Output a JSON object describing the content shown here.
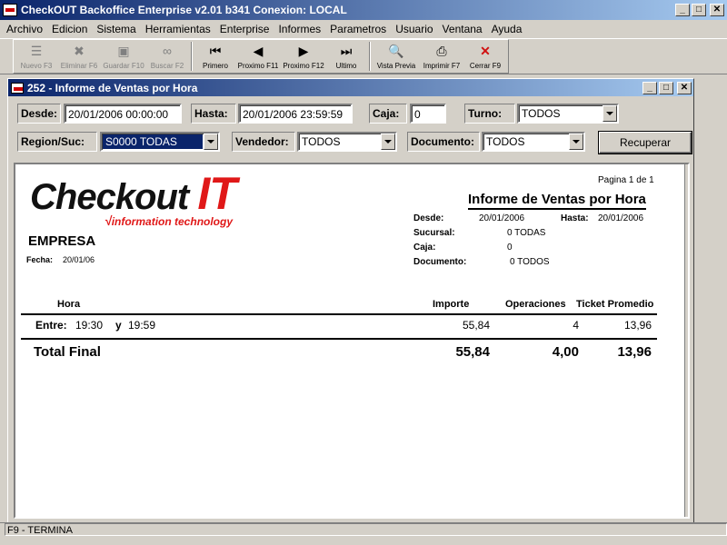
{
  "app": {
    "title": "CheckOUT Backoffice Enterprise v2.01 b341 Conexion: LOCAL"
  },
  "window_buttons": {
    "minimize": "_",
    "maximize": "□",
    "close": "✕"
  },
  "menu": [
    "Archivo",
    "Edicion",
    "Sistema",
    "Herramientas",
    "Enterprise",
    "Informes",
    "Parametros",
    "Usuario",
    "Ventana",
    "Ayuda"
  ],
  "toolbar": {
    "buttons": [
      {
        "label": "Nuevo F3",
        "icon": "new-icon",
        "glyph": "☰",
        "enabled": false
      },
      {
        "label": "Eliminar F6",
        "icon": "delete-icon",
        "glyph": "✖",
        "enabled": false
      },
      {
        "label": "Guardar F10",
        "icon": "save-icon",
        "glyph": "▣",
        "enabled": false
      },
      {
        "label": "Buscar F2",
        "icon": "binoculars-icon",
        "glyph": "∞",
        "enabled": false
      },
      {
        "label": "Primero",
        "icon": "first-icon",
        "glyph": "⏮",
        "enabled": true
      },
      {
        "label": "Proximo F11",
        "icon": "previous-icon",
        "glyph": "◀",
        "enabled": true
      },
      {
        "label": "Proximo F12",
        "icon": "next-icon",
        "glyph": "▶",
        "enabled": true
      },
      {
        "label": "Ultimo",
        "icon": "last-icon",
        "glyph": "⏭",
        "enabled": true
      },
      {
        "label": "Vista Previa",
        "icon": "preview-icon",
        "glyph": "🔍",
        "enabled": true
      },
      {
        "label": "Imprimir F7",
        "icon": "printer-icon",
        "glyph": "⎙",
        "enabled": true
      },
      {
        "label": "Cerrar F9",
        "icon": "close-x-icon",
        "glyph": "✕",
        "enabled": true
      }
    ]
  },
  "child_window": {
    "title": "252 - Informe de Ventas por Hora"
  },
  "filters": {
    "desde_label": "Desde:",
    "desde_value": "20/01/2006 00:00:00",
    "hasta_label": "Hasta:",
    "hasta_value": "20/01/2006 23:59:59",
    "caja_label": "Caja:",
    "caja_value": "0",
    "turno_label": "Turno:",
    "turno_value": "TODOS",
    "region_label": "Region/Suc:",
    "region_value": "S0000 TODAS",
    "vendedor_label": "Vendedor:",
    "vendedor_value": "TODOS",
    "documento_label": "Documento:",
    "documento_value": "TODOS",
    "recuperar_label": "Recuperar"
  },
  "report": {
    "logo_word": "Checkout ",
    "logo_it": "IT",
    "logo_sub": "information technology",
    "pagina": "Pagina 1 de 1",
    "title": "Informe de Ventas por Hora",
    "empresa": "EMPRESA",
    "fecha_label": "Fecha:",
    "fecha_value": "20/01/06",
    "desde_label": "Desde:",
    "desde_value": "20/01/2006",
    "hasta_label": "Hasta:",
    "hasta_value": "20/01/2006",
    "sucursal_label": "Sucursal:",
    "sucursal_value": "0 TODAS",
    "caja_label": "Caja:",
    "caja_value": "0",
    "documento_label": "Documento:",
    "documento_value": "0 TODOS",
    "columns": {
      "hora": "Hora",
      "importe": "Importe",
      "operaciones": "Operaciones",
      "ticket_promedio": "Ticket Promedio"
    },
    "row": {
      "entre_label": "Entre:",
      "from": "19:30",
      "y": "y",
      "to": "19:59",
      "importe": "55,84",
      "operaciones": "4",
      "ticket": "13,96"
    },
    "total": {
      "label": "Total Final",
      "importe": "55,84",
      "operaciones": "4,00",
      "ticket": "13,96"
    }
  },
  "status": {
    "text": "F9 - TERMINA"
  }
}
